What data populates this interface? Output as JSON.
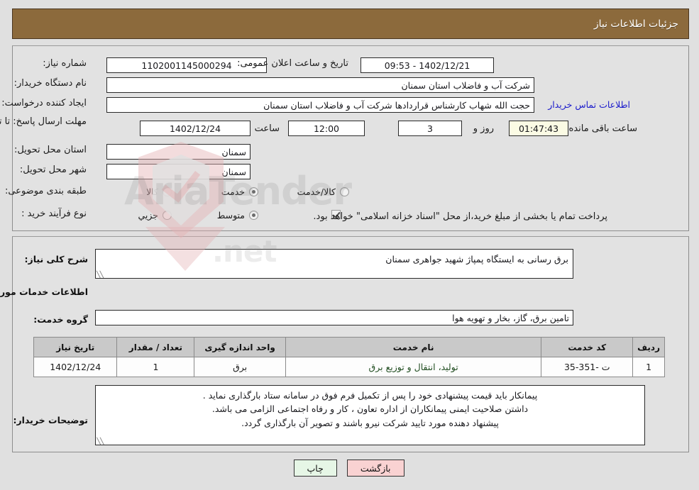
{
  "header": {
    "title": "جزئیات اطلاعات نیاز",
    "bar_color": "#8c6a3c"
  },
  "need_info": {
    "need_number_label": "شماره نیاز:",
    "need_number_value": "1102001145000294",
    "announce_label": "تاریخ و ساعت اعلان عمومی:",
    "announce_value": "1402/12/21 - 09:53",
    "buyer_org_label": "نام دستگاه خریدار:",
    "buyer_org_value": "شرکت آب و فاضلاب استان سمنان",
    "requester_label": "ایجاد کننده درخواست:",
    "requester_value": "حجت الله شهاب کارشناس قراردادها شرکت آب و فاضلاب استان سمنان",
    "contact_link": "اطلاعات تماس خریدار",
    "deadline_label": "مهلت ارسال پاسخ: تا تاریخ:",
    "deadline_date": "1402/12/24",
    "time_label": "ساعت",
    "deadline_time": "12:00",
    "days_value": "3",
    "days_label": "روز و",
    "timer_value": "01:47:43",
    "remaining_label": "ساعت باقی مانده",
    "province_label": "استان محل تحویل:",
    "province_value": "سمنان",
    "city_label": "شهر محل تحویل:",
    "city_value": "سمنان",
    "category_label": "طبقه بندی موضوعی:",
    "category_options": [
      {
        "label": "کالا",
        "selected": false
      },
      {
        "label": "خدمت",
        "selected": true
      },
      {
        "label": "کالا/خدمت",
        "selected": false
      }
    ],
    "process_label": "نوع فرآیند خرید :",
    "process_options": [
      {
        "label": "جزیي",
        "selected": false
      },
      {
        "label": "متوسط",
        "selected": true
      }
    ],
    "treasury_checkbox_checked": true,
    "treasury_text": "پرداخت تمام یا بخشی از مبلغ خرید،از محل \"اسناد خزانه اسلامی\" خواهد بود."
  },
  "details": {
    "summary_label": "شرح کلی نیاز:",
    "summary_value": "برق رسانی به ایستگاه پمپاژ شهید جواهری سمنان",
    "services_heading": "اطلاعات خدمات مورد نیاز",
    "service_group_label": "گروه خدمت:",
    "service_group_value": "تامین برق، گاز، بخار و تهویه هوا",
    "notes_label": "توضیحات خریدار:",
    "notes_lines": [
      "پیمانکار باید قیمت پیشنهادی خود را پس از تکمیل فرم فوق در سامانه ستاد بارگذاری نماید .",
      "داشتن صلاحیت ایمنی پیمانکاران از اداره تعاون ، کار و رفاه اجتماعی الزامی می باشد.",
      "پیشنهاد دهنده مورد تایید شرکت نیرو باشند و تصویر آن بارگذاری گردد."
    ]
  },
  "table": {
    "headers": [
      "ردیف",
      "کد خدمت",
      "نام خدمت",
      "واحد اندازه گیری",
      "تعداد / مقدار",
      "تاریخ نیاز"
    ],
    "rows": [
      {
        "radif": "1",
        "code": "ت -351-35",
        "name": "تولید، انتقال و توزیع برق",
        "unit": "برق",
        "qty": "1",
        "date": "1402/12/24"
      }
    ]
  },
  "buttons": {
    "print": "چاپ",
    "back": "بازگشت"
  },
  "watermark": {
    "line1": "AriaTender",
    "line2": ".net"
  }
}
